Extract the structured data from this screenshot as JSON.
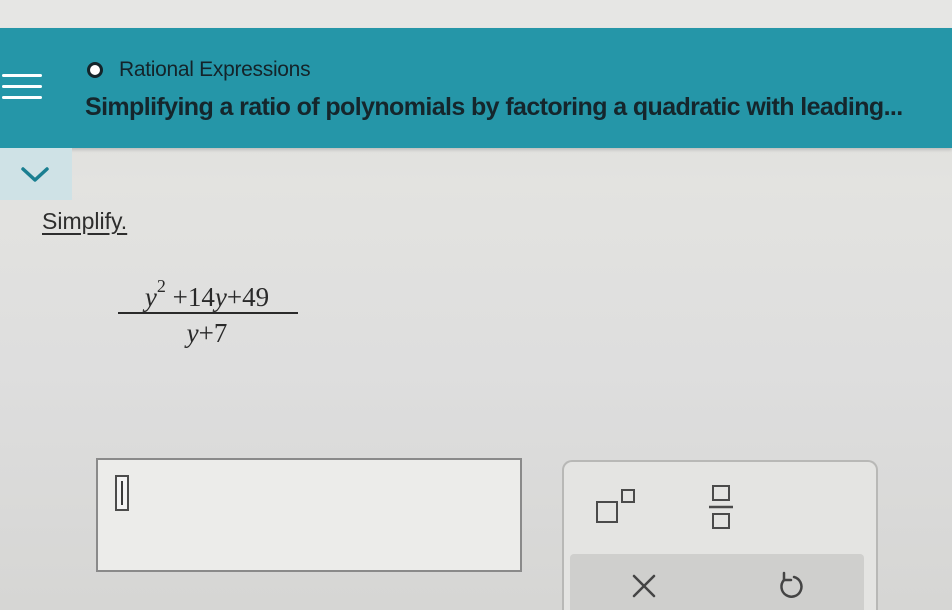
{
  "header": {
    "topic": "Rational Expressions",
    "lesson": "Simplifying a ratio of polynomials by factoring a quadratic with leading..."
  },
  "problem": {
    "instruction": "Simplify.",
    "numerator": {
      "var": "y",
      "exponent": "2",
      "rest_op1": "+14",
      "rest_var": "y",
      "rest_op2": "+49"
    },
    "denominator": {
      "var": "y",
      "rest": "+7"
    }
  },
  "keypad": {
    "keys": [
      "superscript-key",
      "fraction-key",
      "clear-key",
      "undo-key"
    ]
  },
  "colors": {
    "header_bg": "#2596a8",
    "title_text": "#15262c",
    "page_bg": "#dcdcda"
  }
}
